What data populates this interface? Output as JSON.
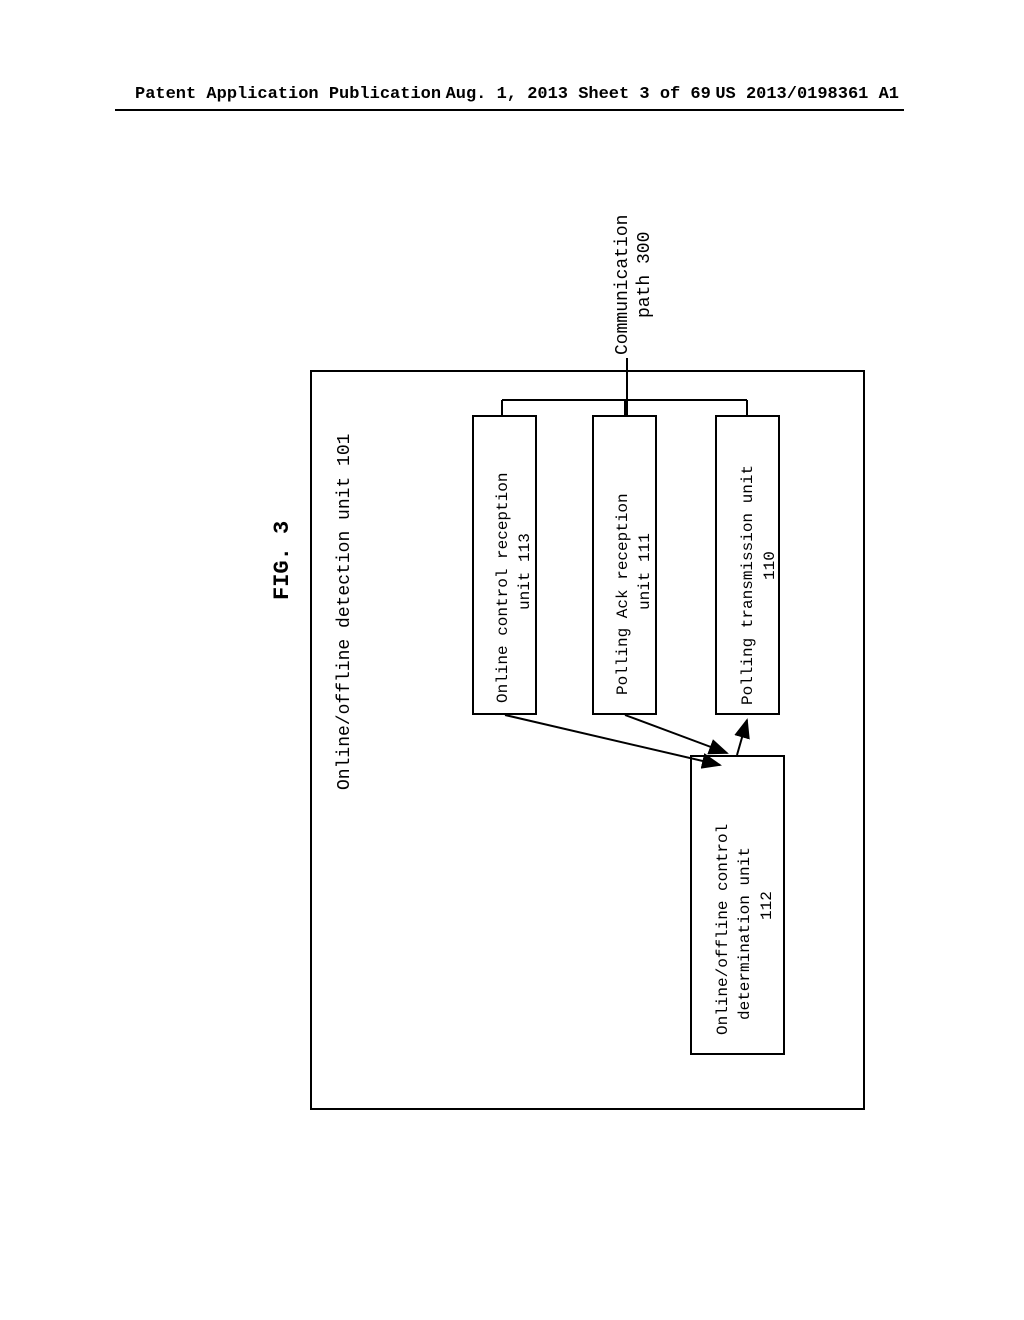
{
  "header": {
    "left": "Patent Application Publication",
    "center": "Aug. 1, 2013  Sheet 3 of 69",
    "right": "US 2013/0198361 A1"
  },
  "figure": {
    "label": "FIG. 3",
    "outer_unit": "Online/offline detection unit 101",
    "boxes": {
      "b110_line1": "Polling transmission unit",
      "b110_line2": "110",
      "b111_line1": "Polling Ack reception",
      "b111_line2": "unit 111",
      "b113_line1": "Online control reception",
      "b113_line2": "unit 113",
      "b112_line1": "Online/offline control",
      "b112_line2": "determination unit",
      "b112_line3": "112"
    },
    "external": {
      "comm_line1": "Communication",
      "comm_line2": "path 300"
    }
  }
}
